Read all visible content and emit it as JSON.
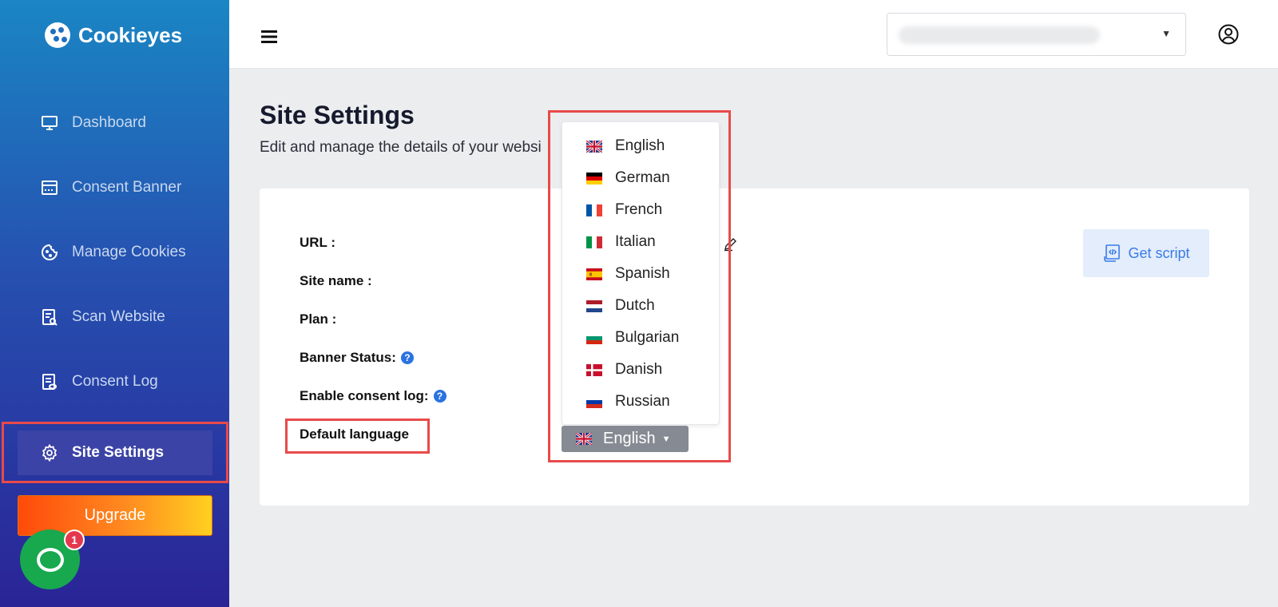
{
  "app": {
    "logo_text": "Cookieyes"
  },
  "sidebar": {
    "items": [
      {
        "label": "Dashboard",
        "icon": "monitor-icon"
      },
      {
        "label": "Consent Banner",
        "icon": "browser-window-icon"
      },
      {
        "label": "Manage Cookies",
        "icon": "cookie-icon"
      },
      {
        "label": "Scan Website",
        "icon": "scan-list-icon"
      },
      {
        "label": "Consent Log",
        "icon": "log-eye-icon"
      },
      {
        "label": "Site Settings",
        "icon": "gear-icon",
        "active": true
      }
    ],
    "upgrade_label": "Upgrade"
  },
  "chat": {
    "badge_count": "1"
  },
  "topbar": {
    "menu_icon": "hamburger-icon",
    "user_icon": "user-circle-icon"
  },
  "page": {
    "title": "Site Settings",
    "subtitle": "Edit and manage the details of your websi"
  },
  "form": {
    "url_label": "URL :",
    "site_name_label": "Site name :",
    "plan_label": "Plan :",
    "banner_status_label": "Banner Status:",
    "consent_log_label": "Enable consent log:",
    "default_language_label": "Default language",
    "help_glyph": "?"
  },
  "get_script_label": "Get script",
  "language_dropdown": {
    "selected": "English",
    "options": [
      {
        "label": "English",
        "flag": "uk-flag-icon"
      },
      {
        "label": "German",
        "flag": "de-flag-icon"
      },
      {
        "label": "French",
        "flag": "fr-flag-icon"
      },
      {
        "label": "Italian",
        "flag": "it-flag-icon"
      },
      {
        "label": "Spanish",
        "flag": "es-flag-icon"
      },
      {
        "label": "Dutch",
        "flag": "nl-flag-icon"
      },
      {
        "label": "Bulgarian",
        "flag": "bg-flag-icon"
      },
      {
        "label": "Danish",
        "flag": "dk-flag-icon"
      },
      {
        "label": "Russian",
        "flag": "ru-flag-icon"
      }
    ]
  },
  "colors": {
    "sidebar_top": "#1a86c4",
    "sidebar_bottom": "#2a2496",
    "highlight_red": "#e84a4a",
    "accent_blue": "#3a7be8",
    "chat_green": "#18a84e"
  }
}
